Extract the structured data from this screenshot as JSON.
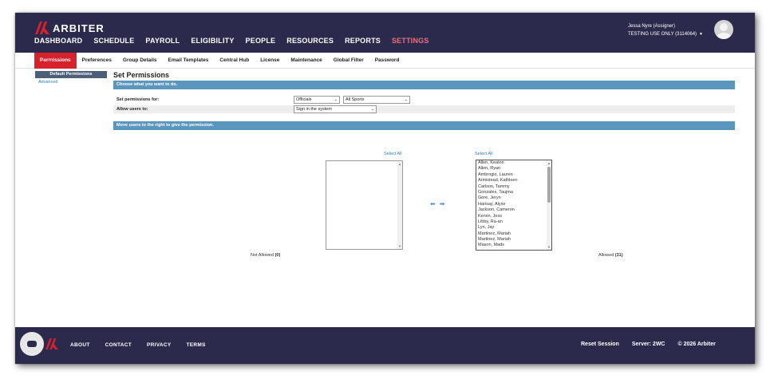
{
  "brand": {
    "name": "ARBITER",
    "accent": "#d8212b",
    "navy": "#2b2a4c"
  },
  "main_nav": [
    {
      "label": "DASHBOARD"
    },
    {
      "label": "SCHEDULE"
    },
    {
      "label": "PAYROLL"
    },
    {
      "label": "ELIGIBILITY"
    },
    {
      "label": "PEOPLE"
    },
    {
      "label": "RESOURCES"
    },
    {
      "label": "REPORTS"
    },
    {
      "label": "SETTINGS",
      "active": true
    }
  ],
  "user": {
    "name": "Jessa Nyre (Assigner)",
    "org": "TESTING USE ONLY (3114064)"
  },
  "sub_nav": [
    {
      "label": "Permissions",
      "active": true
    },
    {
      "label": "Preferences"
    },
    {
      "label": "Group Details"
    },
    {
      "label": "Email Templates"
    },
    {
      "label": "Central Hub"
    },
    {
      "label": "License"
    },
    {
      "label": "Maintenance"
    },
    {
      "label": "Global Filter"
    },
    {
      "label": "Password"
    }
  ],
  "left_menu": [
    {
      "label": "Default Permissions",
      "active": true
    },
    {
      "label": "Advanced"
    }
  ],
  "page": {
    "title": "Set Permissions",
    "section1": "Choose what you want to do.",
    "set_for_label": "Set permissions for:",
    "set_for_value": "Officials",
    "sport_value": "All Sports",
    "allow_label": "Allow users to:",
    "allow_value": "Sign in the system",
    "section2": "Move users to the right to give the permission.",
    "select_all_left": "Select All",
    "select_all_right": "Select All",
    "not_allowed_label": "Not Allowed",
    "not_allowed_count": "(0)",
    "allowed_label": "Allowed",
    "allowed_count": "(31)"
  },
  "allowed_users": [
    "Allen, Keaton",
    "Allen, Ryan",
    "Ambrogio, Lauren",
    "Armistead, Kathleen",
    "Carlson, Tammy",
    "Gonzales, Taujma",
    "Gore, Jeryn",
    "Harisay, Alyse",
    "Jackson, Cameron",
    "Kervin, Jess",
    "Libby, Ra-an",
    "Lyn, Jay",
    "Martinez, Mariah",
    "Martinez, Mariah",
    "Mason, Mads"
  ],
  "footer": {
    "links": [
      {
        "label": "ABOUT"
      },
      {
        "label": "CONTACT"
      },
      {
        "label": "PRIVACY"
      },
      {
        "label": "TERMS"
      }
    ],
    "reset": "Reset Session",
    "server": "Server: 2WC",
    "copyright": "© 2026 Arbiter"
  },
  "icons": {
    "arrow_left": "arrow-left-icon",
    "arrow_right": "arrow-right-icon",
    "chat": "chat-icon",
    "avatar": "user-avatar-icon"
  }
}
